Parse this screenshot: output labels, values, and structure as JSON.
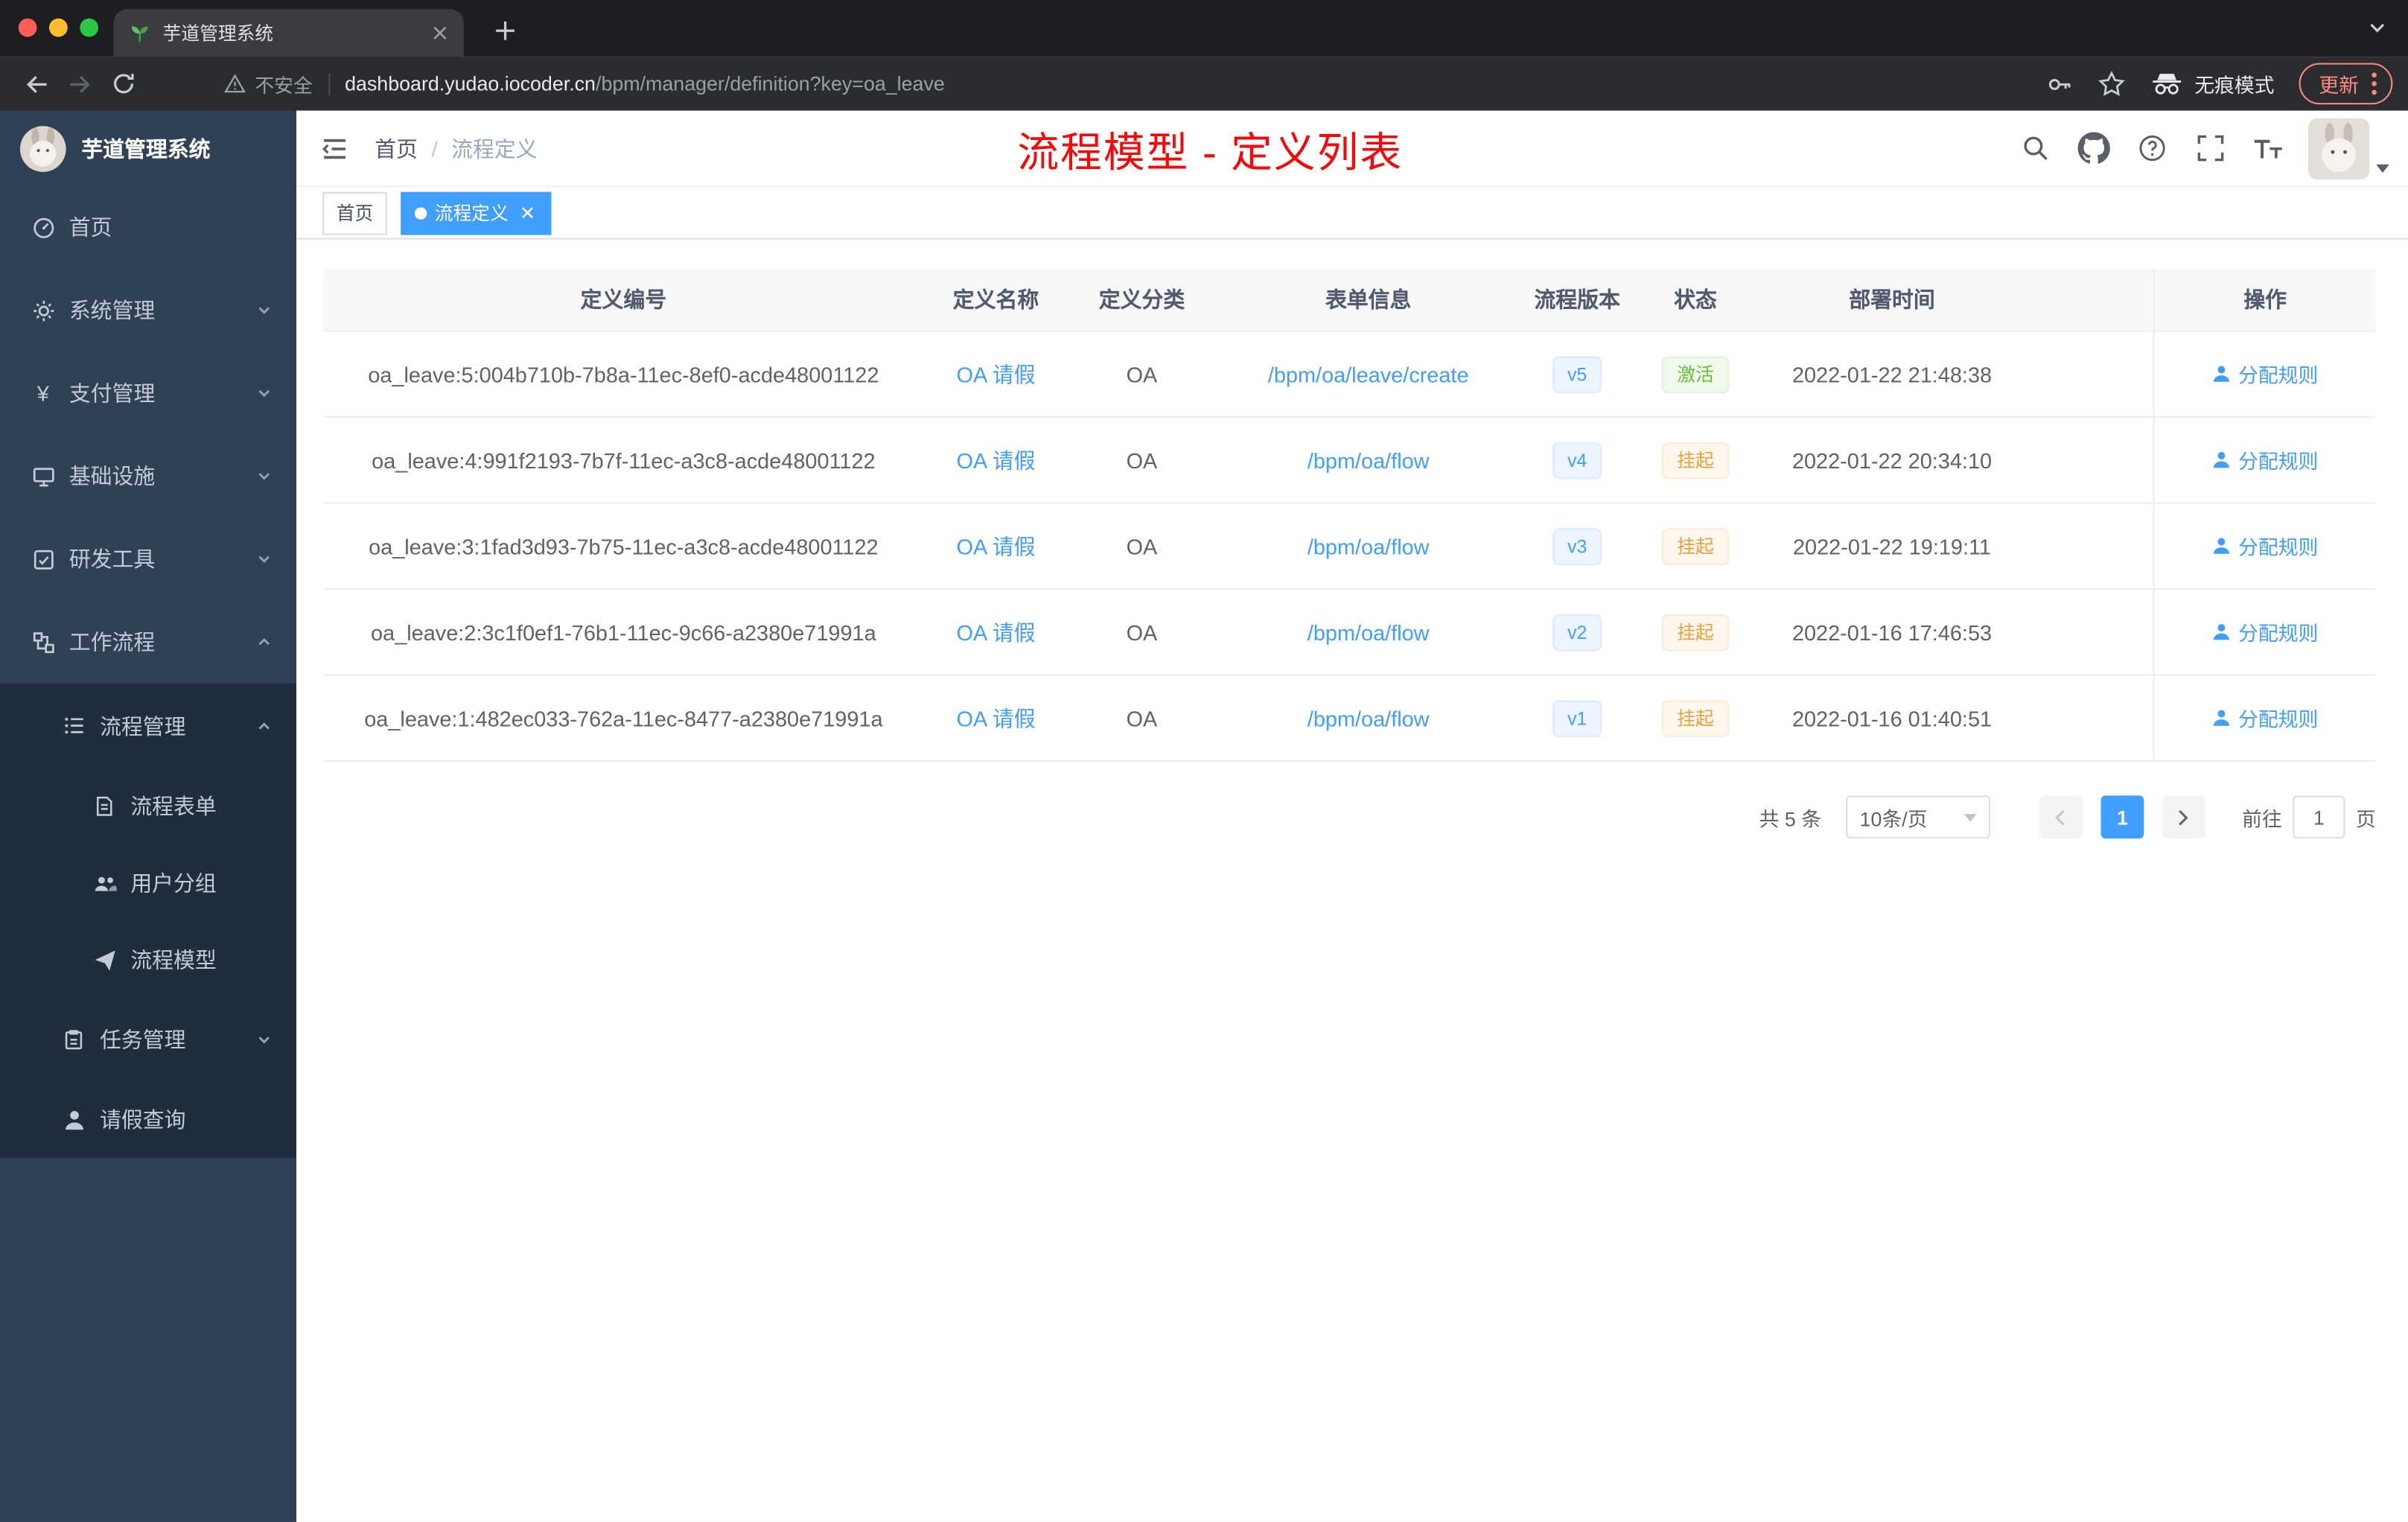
{
  "browser": {
    "tab_title": "芋道管理系统",
    "security_label": "不安全",
    "url_domain": "dashboard.yudao.iocoder.cn",
    "url_path": "/bpm/manager/definition?key=oa_leave",
    "incognito_label": "无痕模式",
    "update_label": "更新"
  },
  "sidebar": {
    "logo_title": "芋道管理系统",
    "items": [
      {
        "label": "首页"
      },
      {
        "label": "系统管理"
      },
      {
        "label": "支付管理"
      },
      {
        "label": "基础设施"
      },
      {
        "label": "研发工具"
      },
      {
        "label": "工作流程"
      },
      {
        "label": "流程管理"
      },
      {
        "label": "流程表单"
      },
      {
        "label": "用户分组"
      },
      {
        "label": "流程模型"
      },
      {
        "label": "任务管理"
      },
      {
        "label": "请假查询"
      }
    ]
  },
  "icons": {
    "yen": "¥"
  },
  "header": {
    "breadcrumb_home": "首页",
    "breadcrumb_separator": "/",
    "breadcrumb_current": "流程定义",
    "annotation": "流程模型 - 定义列表"
  },
  "tags": {
    "home": "首页",
    "active": "流程定义"
  },
  "table": {
    "columns": [
      "定义编号",
      "定义名称",
      "定义分类",
      "表单信息",
      "流程版本",
      "状态",
      "部署时间",
      "操作"
    ],
    "rows": [
      {
        "id": "oa_leave:5:004b710b-7b8a-11ec-8ef0-acde48001122",
        "name": "OA 请假",
        "category": "OA",
        "form": "/bpm/oa/leave/create",
        "version": "v5",
        "status": "激活",
        "status_type": "success",
        "deployed_at": "2022-01-22 21:48:38",
        "action": "分配规则"
      },
      {
        "id": "oa_leave:4:991f2193-7b7f-11ec-a3c8-acde48001122",
        "name": "OA 请假",
        "category": "OA",
        "form": "/bpm/oa/flow",
        "version": "v4",
        "status": "挂起",
        "status_type": "warning",
        "deployed_at": "2022-01-22 20:34:10",
        "action": "分配规则"
      },
      {
        "id": "oa_leave:3:1fad3d93-7b75-11ec-a3c8-acde48001122",
        "name": "OA 请假",
        "category": "OA",
        "form": "/bpm/oa/flow",
        "version": "v3",
        "status": "挂起",
        "status_type": "warning",
        "deployed_at": "2022-01-22 19:19:11",
        "action": "分配规则"
      },
      {
        "id": "oa_leave:2:3c1f0ef1-76b1-11ec-9c66-a2380e71991a",
        "name": "OA 请假",
        "category": "OA",
        "form": "/bpm/oa/flow",
        "version": "v2",
        "status": "挂起",
        "status_type": "warning",
        "deployed_at": "2022-01-16 17:46:53",
        "action": "分配规则"
      },
      {
        "id": "oa_leave:1:482ec033-762a-11ec-8477-a2380e71991a",
        "name": "OA 请假",
        "category": "OA",
        "form": "/bpm/oa/flow",
        "version": "v1",
        "status": "挂起",
        "status_type": "warning",
        "deployed_at": "2022-01-16 01:40:51",
        "action": "分配规则"
      }
    ]
  },
  "pagination": {
    "total": "共 5 条",
    "page_size": "10条/页",
    "current_page": "1",
    "goto_label": "前往",
    "goto_value": "1",
    "unit_label": "页"
  },
  "colors": {
    "accent": "#409eff",
    "success": "#67c23a",
    "warning": "#e6a23c",
    "annotation_red": "#fb0606",
    "sidebar_bg": "#304156",
    "submenu_bg": "#1f2d3d"
  }
}
